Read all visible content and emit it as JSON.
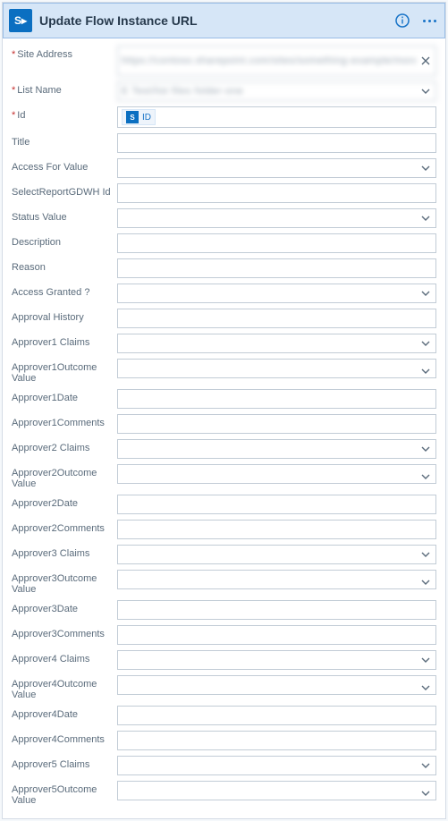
{
  "header": {
    "icon_label": "S▸",
    "title": "Update Flow Instance URL"
  },
  "site_address": {
    "label": "Site Address",
    "value": "https://contoso.sharepoint.com/sites/something-example/more"
  },
  "list_name": {
    "label": "List Name",
    "value": "E Test/list files folder-one"
  },
  "chip_id_label": "ID",
  "fields": [
    {
      "key": "id",
      "label": "Id",
      "required": true,
      "type": "chip"
    },
    {
      "key": "title",
      "label": "Title",
      "required": false,
      "type": "text"
    },
    {
      "key": "access_for_value",
      "label": "Access For Value",
      "required": false,
      "type": "select"
    },
    {
      "key": "selectreport_id",
      "label": "SelectReportGDWH Id",
      "required": false,
      "type": "text"
    },
    {
      "key": "status_value",
      "label": "Status Value",
      "required": false,
      "type": "select"
    },
    {
      "key": "description",
      "label": "Description",
      "required": false,
      "type": "text"
    },
    {
      "key": "reason",
      "label": "Reason",
      "required": false,
      "type": "text"
    },
    {
      "key": "access_granted",
      "label": "Access Granted ?",
      "required": false,
      "type": "select"
    },
    {
      "key": "approval_history",
      "label": "Approval History",
      "required": false,
      "type": "text"
    },
    {
      "key": "approver1_claims",
      "label": "Approver1 Claims",
      "required": false,
      "type": "select"
    },
    {
      "key": "approver1_outcome",
      "label": "Approver1Outcome Value",
      "required": false,
      "type": "select"
    },
    {
      "key": "approver1_date",
      "label": "Approver1Date",
      "required": false,
      "type": "text"
    },
    {
      "key": "approver1_comments",
      "label": "Approver1Comments",
      "required": false,
      "type": "text"
    },
    {
      "key": "approver2_claims",
      "label": "Approver2 Claims",
      "required": false,
      "type": "select"
    },
    {
      "key": "approver2_outcome",
      "label": "Approver2Outcome Value",
      "required": false,
      "type": "select"
    },
    {
      "key": "approver2_date",
      "label": "Approver2Date",
      "required": false,
      "type": "text"
    },
    {
      "key": "approver2_comments",
      "label": "Approver2Comments",
      "required": false,
      "type": "text"
    },
    {
      "key": "approver3_claims",
      "label": "Approver3 Claims",
      "required": false,
      "type": "select"
    },
    {
      "key": "approver3_outcome",
      "label": "Approver3Outcome Value",
      "required": false,
      "type": "select"
    },
    {
      "key": "approver3_date",
      "label": "Approver3Date",
      "required": false,
      "type": "text"
    },
    {
      "key": "approver3_comments",
      "label": "Approver3Comments",
      "required": false,
      "type": "text"
    },
    {
      "key": "approver4_claims",
      "label": "Approver4 Claims",
      "required": false,
      "type": "select"
    },
    {
      "key": "approver4_outcome",
      "label": "Approver4Outcome Value",
      "required": false,
      "type": "select"
    },
    {
      "key": "approver4_date",
      "label": "Approver4Date",
      "required": false,
      "type": "text"
    },
    {
      "key": "approver4_comments",
      "label": "Approver4Comments",
      "required": false,
      "type": "text"
    },
    {
      "key": "approver5_claims",
      "label": "Approver5 Claims",
      "required": false,
      "type": "select"
    },
    {
      "key": "approver5_outcome",
      "label": "Approver5Outcome Value",
      "required": false,
      "type": "select"
    }
  ]
}
